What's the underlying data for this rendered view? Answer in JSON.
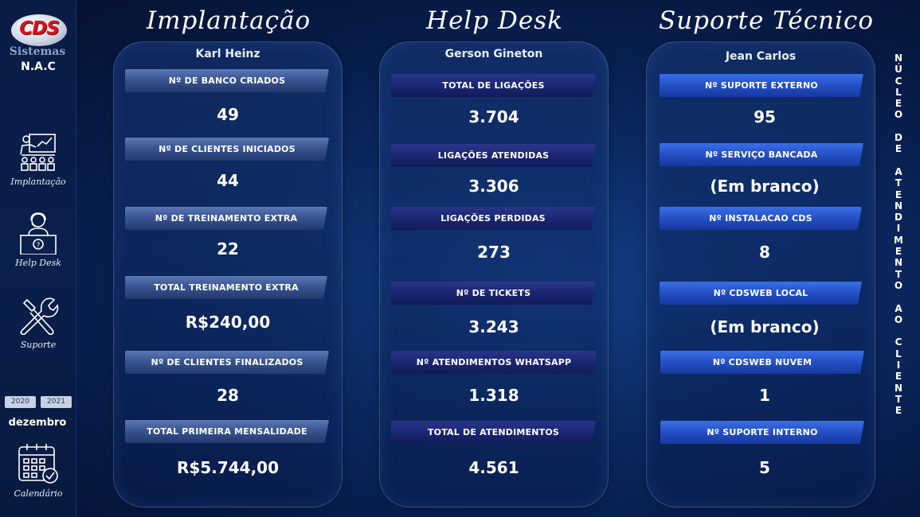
{
  "sidebar": {
    "logo_text": "CDS",
    "logo_sub": "Sistemas",
    "nac": "N.A.C",
    "nav": [
      {
        "label": "Implantação",
        "icon": "presentation-icon"
      },
      {
        "label": "Help Desk",
        "icon": "helpdesk-agent-icon"
      },
      {
        "label": "Suporte",
        "icon": "tools-icon"
      },
      {
        "label": "Calendário",
        "icon": "calendar-icon"
      }
    ],
    "years": [
      "2020",
      "2021"
    ],
    "month": "dezembro"
  },
  "columns": [
    {
      "title": "Implantação",
      "person": "Karl Heinz",
      "metrics": [
        {
          "label": "Nº DE BANCO CRIADOS",
          "value": "49"
        },
        {
          "label": "Nº DE CLIENTES INICIADOS",
          "value": "44"
        },
        {
          "label": "Nº DE TREINAMENTO EXTRA",
          "value": "22"
        },
        {
          "label": "TOTAL TREINAMENTO EXTRA",
          "value": "R$240,00"
        },
        {
          "label": "Nº DE CLIENTES FINALIZADOS",
          "value": "28"
        },
        {
          "label": "TOTAL PRIMEIRA MENSALIDADE",
          "value": "R$5.744,00"
        }
      ]
    },
    {
      "title": "Help Desk",
      "person": "Gerson Gineton",
      "metrics": [
        {
          "label": "TOTAL DE LIGAÇÕES",
          "value": "3.704"
        },
        {
          "label": "LIGAÇÕES ATENDIDAS",
          "value": "3.306"
        },
        {
          "label": "LIGAÇÕES PERDIDAS",
          "value": "273"
        },
        {
          "label": "Nº DE TICKETS",
          "value": "3.243"
        },
        {
          "label": "Nº ATENDIMENTOS WHATSAPP",
          "value": "1.318"
        },
        {
          "label": "TOTAL DE ATENDIMENTOS",
          "value": "4.561"
        }
      ]
    },
    {
      "title": "Suporte Técnico",
      "person": "Jean Carlos",
      "metrics": [
        {
          "label": "Nº SUPORTE EXTERNO",
          "value": "95"
        },
        {
          "label": "Nº SERVIÇO BANCADA",
          "value": "(Em branco)"
        },
        {
          "label": "Nº INSTALACAO CDS",
          "value": "8"
        },
        {
          "label": "Nº CDSWEB LOCAL",
          "value": "(Em branco)"
        },
        {
          "label": "Nº CDSWEB NUVEM",
          "value": "1"
        },
        {
          "label": "Nº SUPORTE INTERNO",
          "value": "5"
        }
      ]
    }
  ],
  "vertical_text": [
    "N",
    "Ú",
    "C",
    "L",
    "E",
    "O",
    " ",
    "D",
    "E",
    " ",
    "A",
    "T",
    "E",
    "N",
    "D",
    "I",
    "M",
    "E",
    "N",
    "T",
    "O",
    " ",
    "A",
    "O",
    " ",
    "C",
    "L",
    "I",
    "E",
    "N",
    "T",
    "E"
  ],
  "colors": {
    "background": "#0b2a63",
    "bar_implantacao": "#3a5592",
    "bar_helpdesk": "#1b2673",
    "bar_suporte": "#2450c4",
    "logo_red": "#d4141c"
  }
}
